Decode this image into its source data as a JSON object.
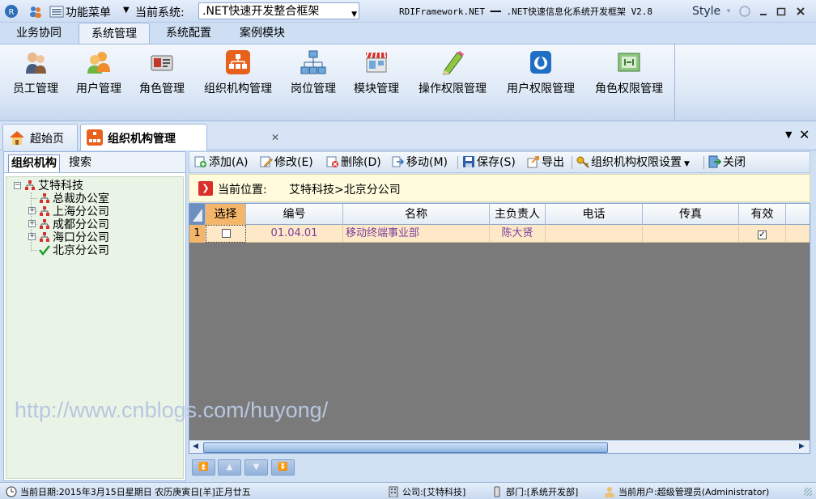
{
  "titlebar": {
    "menu_label": "功能菜单",
    "current_system_label": "当前系统:",
    "current_system_value": ".NET快速开发整合框架",
    "app_title": "RDIFramework.NET ━━ .NET快速信息化系统开发框架 V2.8",
    "style_label": "Style"
  },
  "ribbon_tabs": [
    "业务协同",
    "系统管理",
    "系统配置",
    "案例模块"
  ],
  "ribbon_buttons": [
    "员工管理",
    "用户管理",
    "角色管理",
    "组织机构管理",
    "岗位管理",
    "模块管理",
    "操作权限管理",
    "用户权限管理",
    "角色权限管理"
  ],
  "doc_tabs": [
    "超始页",
    "组织机构管理"
  ],
  "left_panel": {
    "tabs": [
      "组织机构",
      "搜索"
    ],
    "tree": {
      "root": "艾特科技",
      "children": [
        "总裁办公室",
        "上海分公司",
        "成都分公司",
        "海口分公司",
        "北京分公司"
      ]
    }
  },
  "toolbar": {
    "add": "添加(A)",
    "edit": "修改(E)",
    "delete": "删除(D)",
    "move": "移动(M)",
    "save": "保存(S)",
    "export": "导出",
    "permission": "组织机构权限设置",
    "close": "关闭"
  },
  "location": {
    "label": "当前位置:",
    "path": "艾特科技>北京分公司"
  },
  "grid": {
    "columns": [
      "选择",
      "编号",
      "名称",
      "主负责人",
      "电话",
      "传真",
      "有效"
    ],
    "rows": [
      {
        "index": "1",
        "selected": false,
        "code": "01.04.01",
        "name": "移动终端事业部",
        "manager": "陈大贤",
        "phone": "",
        "fax": "",
        "enabled": true
      }
    ]
  },
  "watermark": "http://www.cnblogs.com/huyong/",
  "statusbar": {
    "date": "当前日期:2015年3月15日星期日 农历庚寅日[羊]正月廿五",
    "company": "公司:[艾特科技]",
    "department": "部门:[系统开发部]",
    "user": "当前用户:超级管理员(Administrator)"
  },
  "colors": {
    "accent": "#d9302c",
    "row_highlight": "#fde9c8",
    "tree_bg": "#eaf4e6"
  }
}
